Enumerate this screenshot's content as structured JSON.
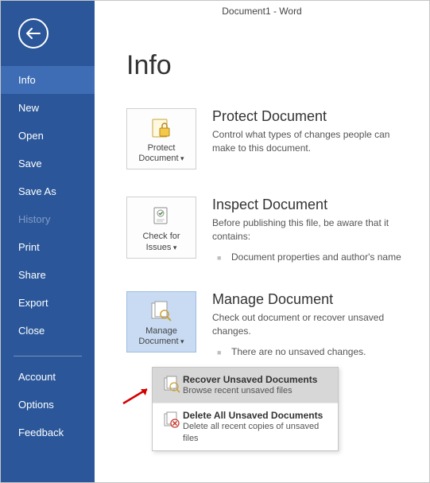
{
  "window_title": "Document1 - Word",
  "page_title": "Info",
  "sidebar": {
    "items": [
      {
        "label": "Info",
        "selected": true,
        "disabled": false
      },
      {
        "label": "New",
        "selected": false,
        "disabled": false
      },
      {
        "label": "Open",
        "selected": false,
        "disabled": false
      },
      {
        "label": "Save",
        "selected": false,
        "disabled": false
      },
      {
        "label": "Save As",
        "selected": false,
        "disabled": false
      },
      {
        "label": "History",
        "selected": false,
        "disabled": true
      },
      {
        "label": "Print",
        "selected": false,
        "disabled": false
      },
      {
        "label": "Share",
        "selected": false,
        "disabled": false
      },
      {
        "label": "Export",
        "selected": false,
        "disabled": false
      },
      {
        "label": "Close",
        "selected": false,
        "disabled": false
      }
    ],
    "bottom_items": [
      {
        "label": "Account"
      },
      {
        "label": "Options"
      },
      {
        "label": "Feedback"
      }
    ]
  },
  "sections": {
    "protect": {
      "tile_label": "Protect Document",
      "heading": "Protect Document",
      "desc": "Control what types of changes people can make to this document."
    },
    "inspect": {
      "tile_label": "Check for Issues",
      "heading": "Inspect Document",
      "desc": "Before publishing this file, be aware that it contains:",
      "bullet1": "Document properties and author's name"
    },
    "manage": {
      "tile_label": "Manage Document",
      "heading": "Manage Document",
      "desc": "Check out document or recover unsaved changes.",
      "bullet1": "There are no unsaved changes."
    }
  },
  "dropdown": {
    "recover": {
      "title": "Recover Unsaved Documents",
      "desc": "Browse recent unsaved files"
    },
    "delete": {
      "title": "Delete All Unsaved Documents",
      "desc": "Delete all recent copies of unsaved files"
    }
  }
}
